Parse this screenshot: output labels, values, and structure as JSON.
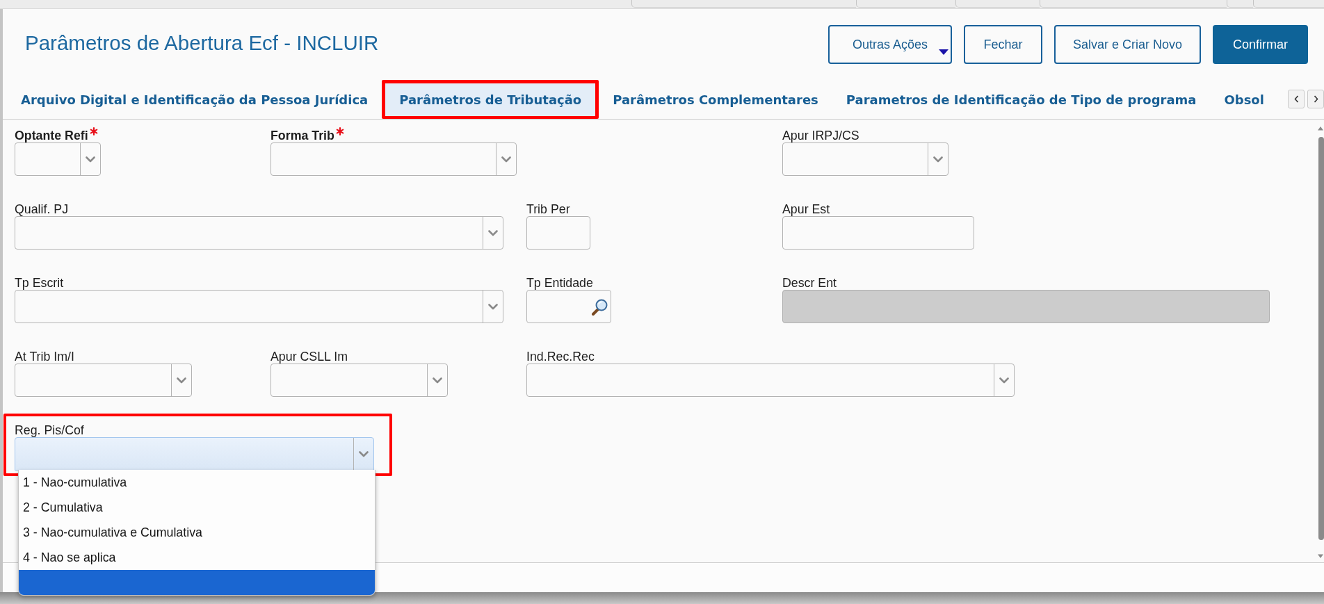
{
  "header": {
    "title": "Parâmetros de Abertura Ecf - INCLUIR",
    "actions": [
      {
        "label": "Outras Ações",
        "kind": "menu"
      },
      {
        "label": "Fechar",
        "kind": "secondary"
      },
      {
        "label": "Salvar e Criar Novo",
        "kind": "secondary"
      },
      {
        "label": "Confirmar",
        "kind": "primary"
      }
    ]
  },
  "tabs": [
    {
      "label": "Arquivo Digital e Identificação da Pessoa Jurídica",
      "selected": false,
      "highlighted": false
    },
    {
      "label": "Parâmetros de Tributação",
      "selected": true,
      "highlighted": true
    },
    {
      "label": "Parâmetros Complementares",
      "selected": false,
      "highlighted": false
    },
    {
      "label": "Parametros de Identificação de Tipo de programa",
      "selected": false,
      "highlighted": false
    },
    {
      "label": "Obsol",
      "selected": false,
      "highlighted": false
    }
  ],
  "form": {
    "rows": [
      {
        "fields": [
          {
            "label": "Optante Refi",
            "kind": "select",
            "required": true,
            "disabled": false,
            "focused": false,
            "highlighted": false
          },
          {
            "label": "Forma Trib",
            "kind": "select",
            "required": true,
            "disabled": false,
            "focused": false,
            "highlighted": false
          },
          {
            "label": "Apur IRPJ/CS",
            "kind": "select",
            "required": false,
            "disabled": false,
            "focused": false,
            "highlighted": false
          }
        ]
      },
      {
        "fields": [
          {
            "label": "Qualif. PJ",
            "kind": "select",
            "required": false,
            "disabled": false,
            "focused": false,
            "highlighted": false
          },
          {
            "label": "Trib Per",
            "kind": "text",
            "required": false,
            "disabled": false,
            "focused": false,
            "highlighted": false
          },
          {
            "label": "Apur Est",
            "kind": "text",
            "required": false,
            "disabled": false,
            "focused": false,
            "highlighted": false
          }
        ]
      },
      {
        "fields": [
          {
            "label": "Tp Escrit",
            "kind": "select",
            "required": false,
            "disabled": false,
            "focused": false,
            "highlighted": false
          },
          {
            "label": "Tp Entidade",
            "kind": "lookup",
            "required": false,
            "disabled": false,
            "focused": false,
            "highlighted": false
          },
          {
            "label": "Descr Ent",
            "kind": "text",
            "required": false,
            "disabled": true,
            "focused": false,
            "highlighted": false
          }
        ]
      },
      {
        "fields": [
          {
            "label": "At Trib Im/I",
            "kind": "select",
            "required": false,
            "disabled": false,
            "focused": false,
            "highlighted": false
          },
          {
            "label": "Apur CSLL Im",
            "kind": "select",
            "required": false,
            "disabled": false,
            "focused": false,
            "highlighted": false
          },
          {
            "label": "Ind.Rec.Rec",
            "kind": "select",
            "required": false,
            "disabled": false,
            "focused": false,
            "highlighted": false
          }
        ]
      },
      {
        "fields": [
          {
            "label": "Reg. Pis/Cof",
            "kind": "select",
            "required": false,
            "disabled": false,
            "focused": true,
            "highlighted": true,
            "expanded": true,
            "options": [
              {
                "label": "1 - Nao-cumulativa",
                "selected": false
              },
              {
                "label": "2 - Cumulativa",
                "selected": false
              },
              {
                "label": "3 - Nao-cumulativa e Cumulativa",
                "selected": false
              },
              {
                "label": "4 - Nao se aplica",
                "selected": false
              },
              {
                "selected": true
              }
            ]
          }
        ]
      }
    ]
  }
}
